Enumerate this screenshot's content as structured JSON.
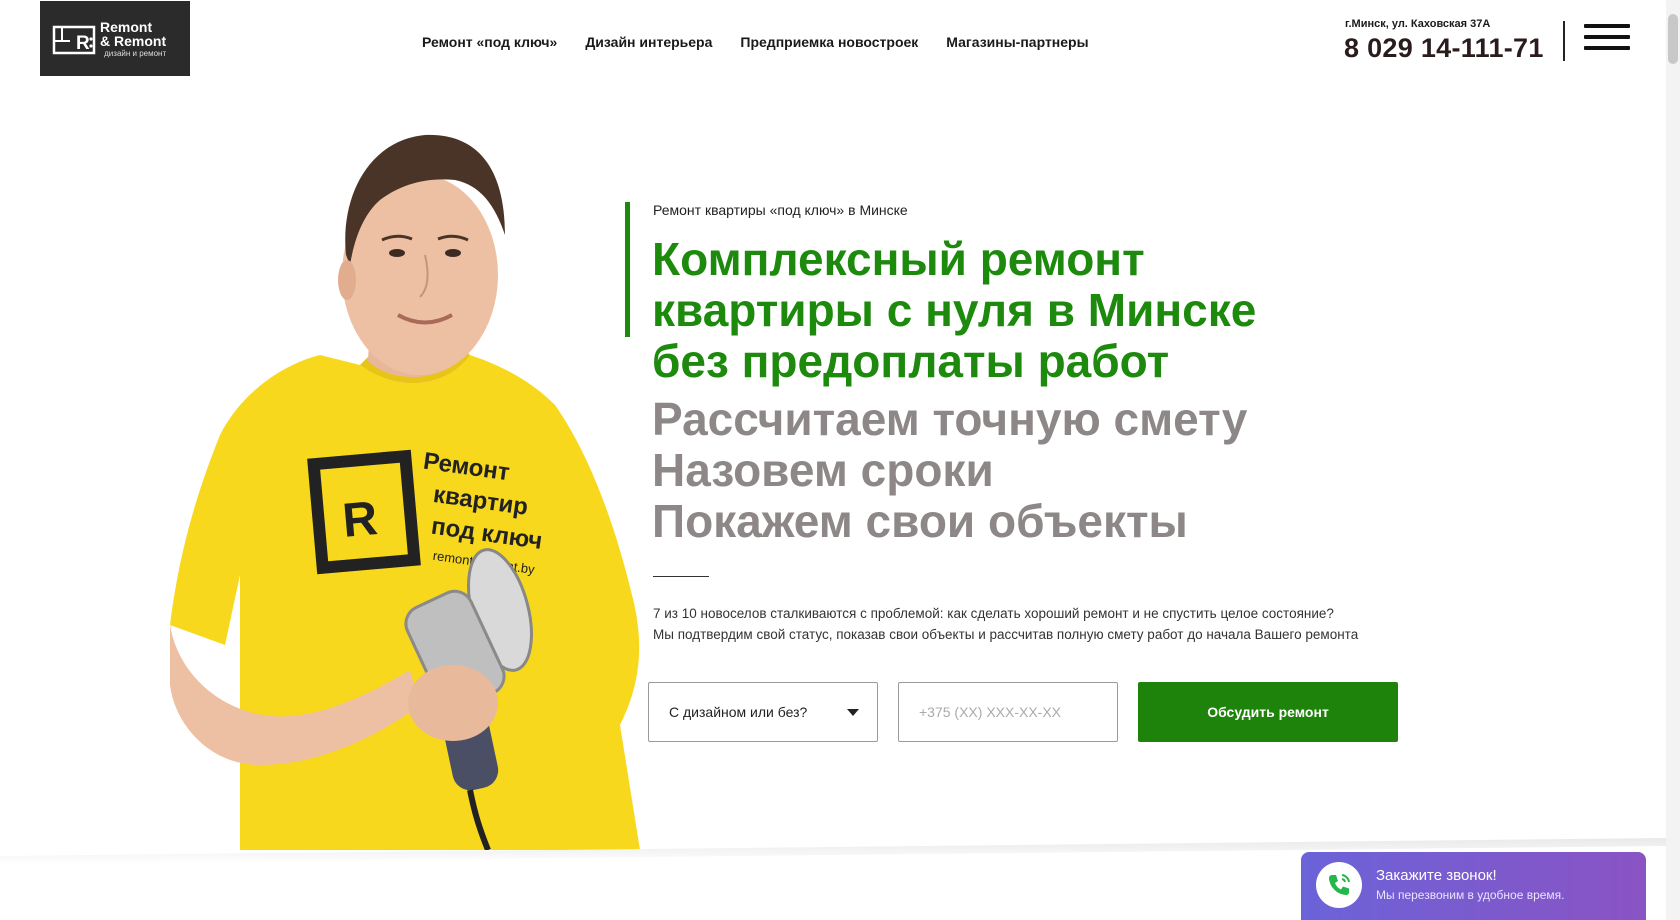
{
  "header": {
    "logo": {
      "line1": "Remont",
      "line2": "& Remont",
      "tagline": "дизайн и ремонт"
    },
    "nav": [
      {
        "label": "Ремонт «под ключ»"
      },
      {
        "label": "Дизайн интерьера"
      },
      {
        "label": "Предприемка новостроек"
      },
      {
        "label": "Магазины-партнеры"
      }
    ],
    "address": "г.Минск, ул. Каховская 37А",
    "phone": "8 029 14-111-71"
  },
  "hero": {
    "eyebrow": "Ремонт квартиры «под ключ» в Минске",
    "headline": [
      "Комплексный ремонт",
      "квартиры с нуля в Минске",
      "без предоплаты работ"
    ],
    "subhead": [
      "Рассчитаем точную смету",
      "Назовем сроки",
      "Покажем свои объекты"
    ],
    "description": [
      "7 из 10 новоселов сталкиваются с проблемой: как сделать хороший ремонт и не спустить целое состояние?",
      "Мы подтвердим свой статус, показав свои объекты и рассчитав полную смету работ до начала Вашего ремонта"
    ],
    "shirt": {
      "l1": "Ремонт",
      "l2": "квартир",
      "l3": "под ключ",
      "l4": "remont-remont.by"
    }
  },
  "form": {
    "select_value": "С дизайном или без?",
    "phone_placeholder": "+375 (XX) XXX-XX-XX",
    "submit_label": "Обсудить ремонт"
  },
  "callback": {
    "title": "Закажите звонок!",
    "subtitle": "Мы перезвоним в удобное время."
  },
  "colors": {
    "brand_green": "#1d8a0e",
    "headline_gray": "#8d8787",
    "shirt_yellow": "#f7d81d",
    "callback_gradient_start": "#6b63d8",
    "callback_gradient_end": "#8a53c4"
  },
  "icons": [
    "logo-mark-icon",
    "chevron-down-icon",
    "hamburger-menu-icon",
    "phone-call-icon"
  ]
}
